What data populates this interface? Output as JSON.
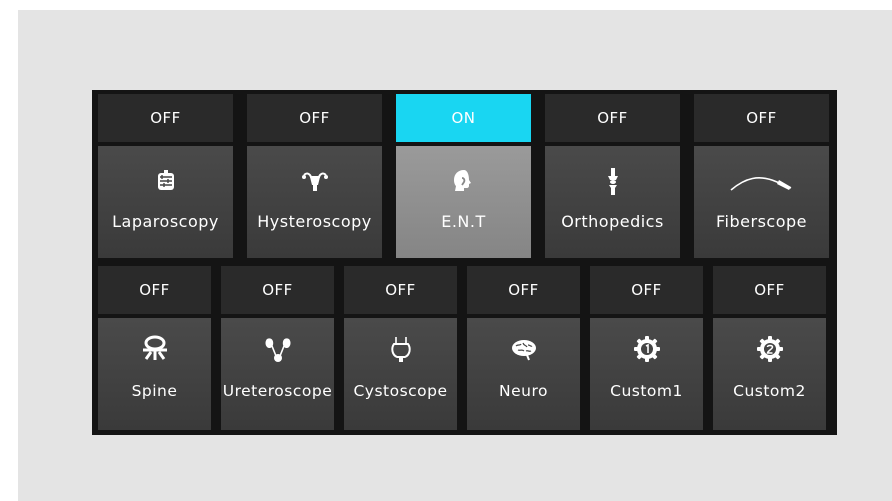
{
  "status_on": "ON",
  "status_off": "OFF",
  "accent": "#19d6f2",
  "row1": [
    {
      "label": "Laparoscopy",
      "status": "OFF",
      "icon": "intestine-icon"
    },
    {
      "label": "Hysteroscopy",
      "status": "OFF",
      "icon": "uterus-icon"
    },
    {
      "label": "E.N.T",
      "status": "ON",
      "icon": "head-icon"
    },
    {
      "label": "Orthopedics",
      "status": "OFF",
      "icon": "knee-joint-icon"
    },
    {
      "label": "Fiberscope",
      "status": "OFF",
      "icon": "fiberscope-icon"
    }
  ],
  "row2": [
    {
      "label": "Spine",
      "status": "OFF",
      "icon": "vertebra-icon"
    },
    {
      "label": "Ureteroscope",
      "status": "OFF",
      "icon": "kidneys-icon"
    },
    {
      "label": "Cystoscope",
      "status": "OFF",
      "icon": "bladder-icon"
    },
    {
      "label": "Neuro",
      "status": "OFF",
      "icon": "brain-icon"
    },
    {
      "label": "Custom1",
      "status": "OFF",
      "icon": "gear-1-icon"
    },
    {
      "label": "Custom2",
      "status": "OFF",
      "icon": "gear-2-icon"
    }
  ]
}
